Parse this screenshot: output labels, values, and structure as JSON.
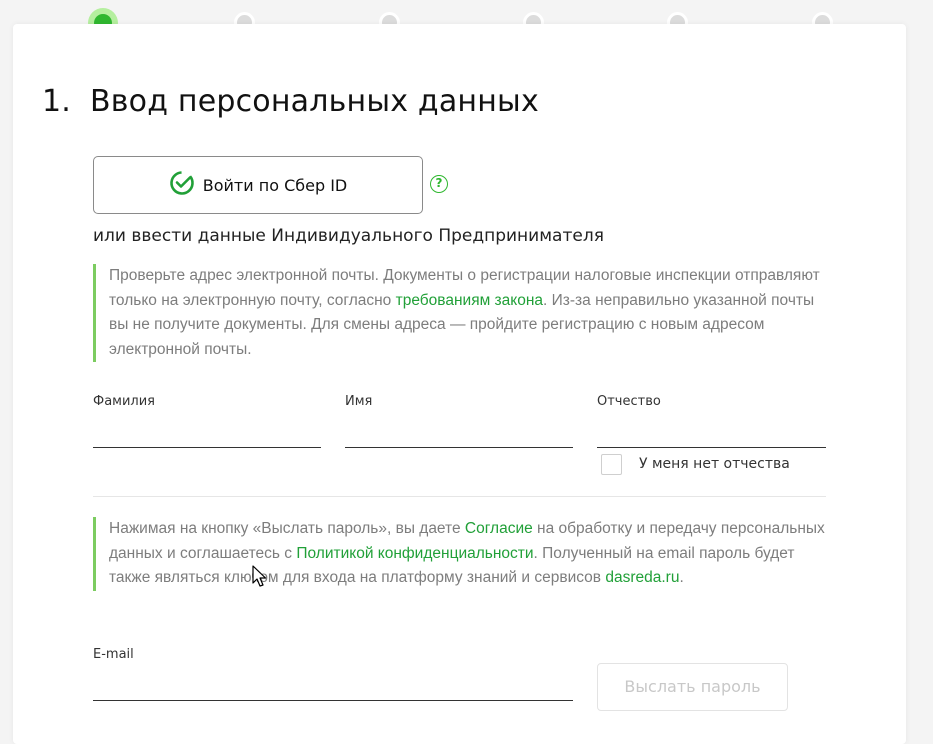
{
  "stepper": {
    "steps": [
      {
        "state": "active"
      },
      {
        "state": "inactive"
      },
      {
        "state": "inactive"
      },
      {
        "state": "inactive"
      },
      {
        "state": "inactive"
      },
      {
        "state": "inactive"
      }
    ],
    "active_color": "#2fb72f"
  },
  "header": {
    "number": "1.",
    "title": "Ввод персональных данных"
  },
  "sber_login": {
    "label": "Войти по Сбер ID",
    "icon": "sber-check-icon",
    "help_icon": "question-circle-icon",
    "help_glyph": "?"
  },
  "alt_text": "или ввести данные Индивидуального Предпринимателя",
  "email_notice": {
    "before": "Проверьте адрес электронной почты. Документы о регистрации налоговые инспекции отправляют только на электронную почту, согласно ",
    "link": "требованиям закона",
    "after": ". Из-за неправильно указанной почты вы не получите документы. Для смены адреса — пройдите регистрацию с новым адресом электронной почты."
  },
  "fields": {
    "last_name": {
      "label": "Фамилия",
      "value": ""
    },
    "first_name": {
      "label": "Имя",
      "value": ""
    },
    "patronymic": {
      "label": "Отчество",
      "value": ""
    },
    "no_patronymic": {
      "label": "У меня нет отчества",
      "checked": false
    },
    "email": {
      "label": "E-mail",
      "value": ""
    }
  },
  "consent_notice": {
    "part1": "Нажимая на кнопку «Выслать пароль», вы даете ",
    "link1": "Согласие",
    "part2": " на обработку и передачу персональных данных и соглашаетесь с ",
    "link2": "Политикой конфиденциальности",
    "part3": ". Полученный на email пароль будет также являться ключом для входа на платформу знаний и сервисов ",
    "link3": "dasreda.ru",
    "part4": "."
  },
  "send_button": {
    "label": "Выслать пароль",
    "disabled": true
  },
  "colors": {
    "accent": "#21a038",
    "notice_border": "#7ccc60",
    "notice_text": "#7d7d7d"
  }
}
